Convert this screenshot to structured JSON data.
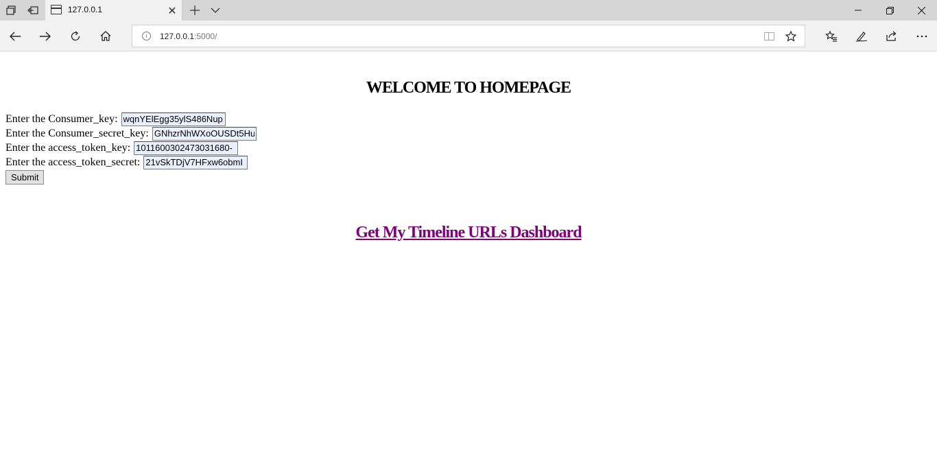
{
  "browser": {
    "tab": {
      "title": "127.0.0.1"
    },
    "address": {
      "host": "127.0.0.1",
      "path": ":5000/"
    },
    "icons": {
      "tab_actions": "tab-actions-icon",
      "set_aside": "set-aside-tabs-icon",
      "new_tab": "plus-icon",
      "tab_preview": "chevron-down-icon",
      "back": "back-arrow-icon",
      "forward": "forward-arrow-icon",
      "refresh": "refresh-icon",
      "home": "home-icon",
      "favorites": "star-icon",
      "hub": "favorites-hub-icon",
      "notes": "pen-icon",
      "share": "share-icon",
      "more": "more-icon"
    }
  },
  "page": {
    "heading": "WELCOME TO HOMEPAGE",
    "form": {
      "fields": [
        {
          "label": "Enter the Consumer_key:",
          "value": "wqnYElEgg35ylS486Nup"
        },
        {
          "label": "Enter the Consumer_secret_key:",
          "value": "GNhzrNhWXoOUSDt5Hu"
        },
        {
          "label": "Enter the access_token_key:",
          "value": "1011600302473031680-"
        },
        {
          "label": "Enter the access_token_secret:",
          "value": "21vSkTDjV7HFxw6obmI"
        }
      ],
      "submit_label": "Submit"
    },
    "dashboard_link": "Get My Timeline URLs Dashboard",
    "colors": {
      "visited_link": "#800080",
      "autofill_bg": "#e8f0fe"
    }
  }
}
